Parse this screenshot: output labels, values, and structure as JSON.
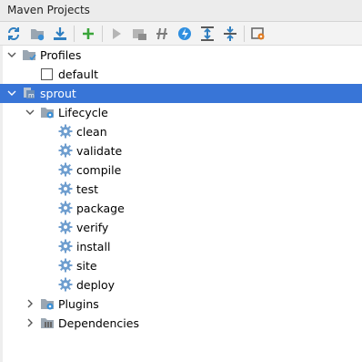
{
  "panel": {
    "title": "Maven Projects"
  },
  "toolbar": {
    "icons": [
      "reimport-icon",
      "generate-sources-icon",
      "download-icon",
      "add-icon",
      "run-icon",
      "execute-goal-icon",
      "toggle-offline-icon",
      "skip-tests-icon",
      "expand-all-icon",
      "collapse-all-icon",
      "settings-icon"
    ]
  },
  "tree": {
    "profiles": {
      "label": "Profiles",
      "items": [
        {
          "label": "default",
          "checked": false
        }
      ]
    },
    "project": {
      "label": "sprout"
    },
    "lifecycle": {
      "label": "Lifecycle",
      "goals": [
        "clean",
        "validate",
        "compile",
        "test",
        "package",
        "verify",
        "install",
        "site",
        "deploy"
      ]
    },
    "plugins": {
      "label": "Plugins"
    },
    "dependencies": {
      "label": "Dependencies"
    }
  }
}
